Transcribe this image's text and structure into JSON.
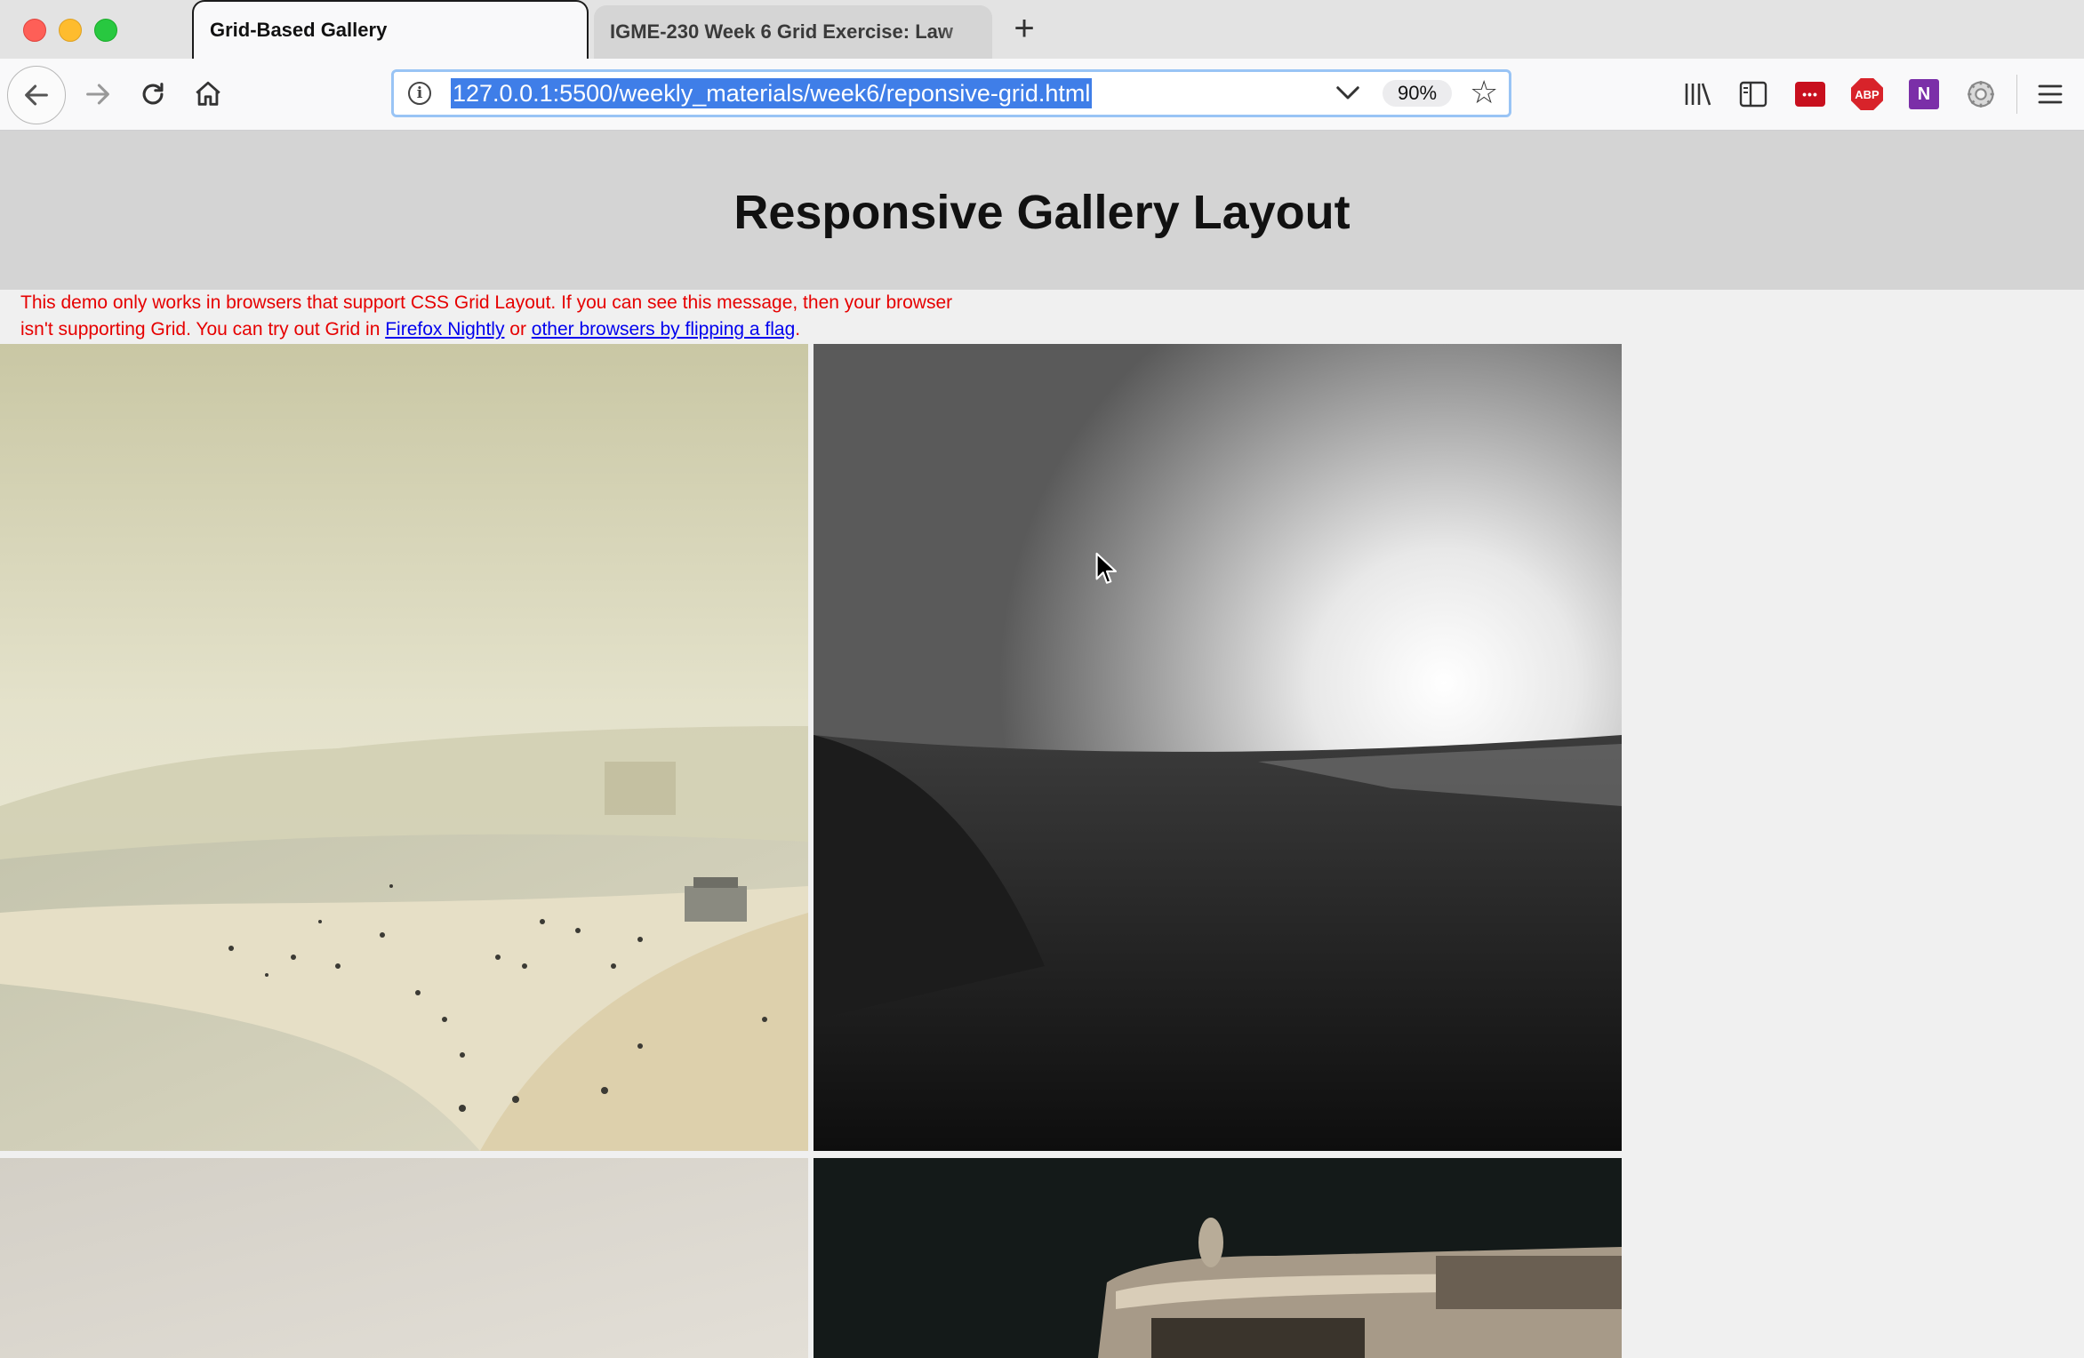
{
  "browser": {
    "tabs": [
      {
        "title": "Grid-Based Gallery",
        "active": true
      },
      {
        "title": "IGME-230 Week 6 Grid Exercise: Law",
        "active": false
      }
    ],
    "url": "127.0.0.1:5500/weekly_materials/week6/reponsive-grid.html",
    "zoom": "90%",
    "toolbar_icons": [
      "library-icon",
      "sidebar-icon",
      "lastpass-icon",
      "adblock-plus-icon",
      "onenote-icon",
      "extension-gear-icon",
      "menu-icon"
    ],
    "extensions": {
      "lastpass": "•••",
      "abp": "ABP",
      "onenote": "N"
    }
  },
  "page": {
    "title": "Responsive Gallery Layout",
    "notice": {
      "text_before": "This demo only works in browsers that support CSS Grid Layout. If you can see this message, then your browser isn't supporting Grid. You can try out Grid in ",
      "link1": "Firefox Nightly",
      "text_middle": " or ",
      "link2": "other browsers by flipping a flag",
      "text_after": "."
    },
    "gallery": [
      {
        "subject": "beach-crowd-photo"
      },
      {
        "subject": "black-and-white-field-photo"
      },
      {
        "subject": "pale-sky-photo"
      },
      {
        "subject": "camera-closeup-photo"
      }
    ]
  },
  "colors": {
    "notice": "#e60000",
    "link": "#0000ee",
    "header_band": "#d4d4d4",
    "url_highlight": "#3f7ee8"
  }
}
